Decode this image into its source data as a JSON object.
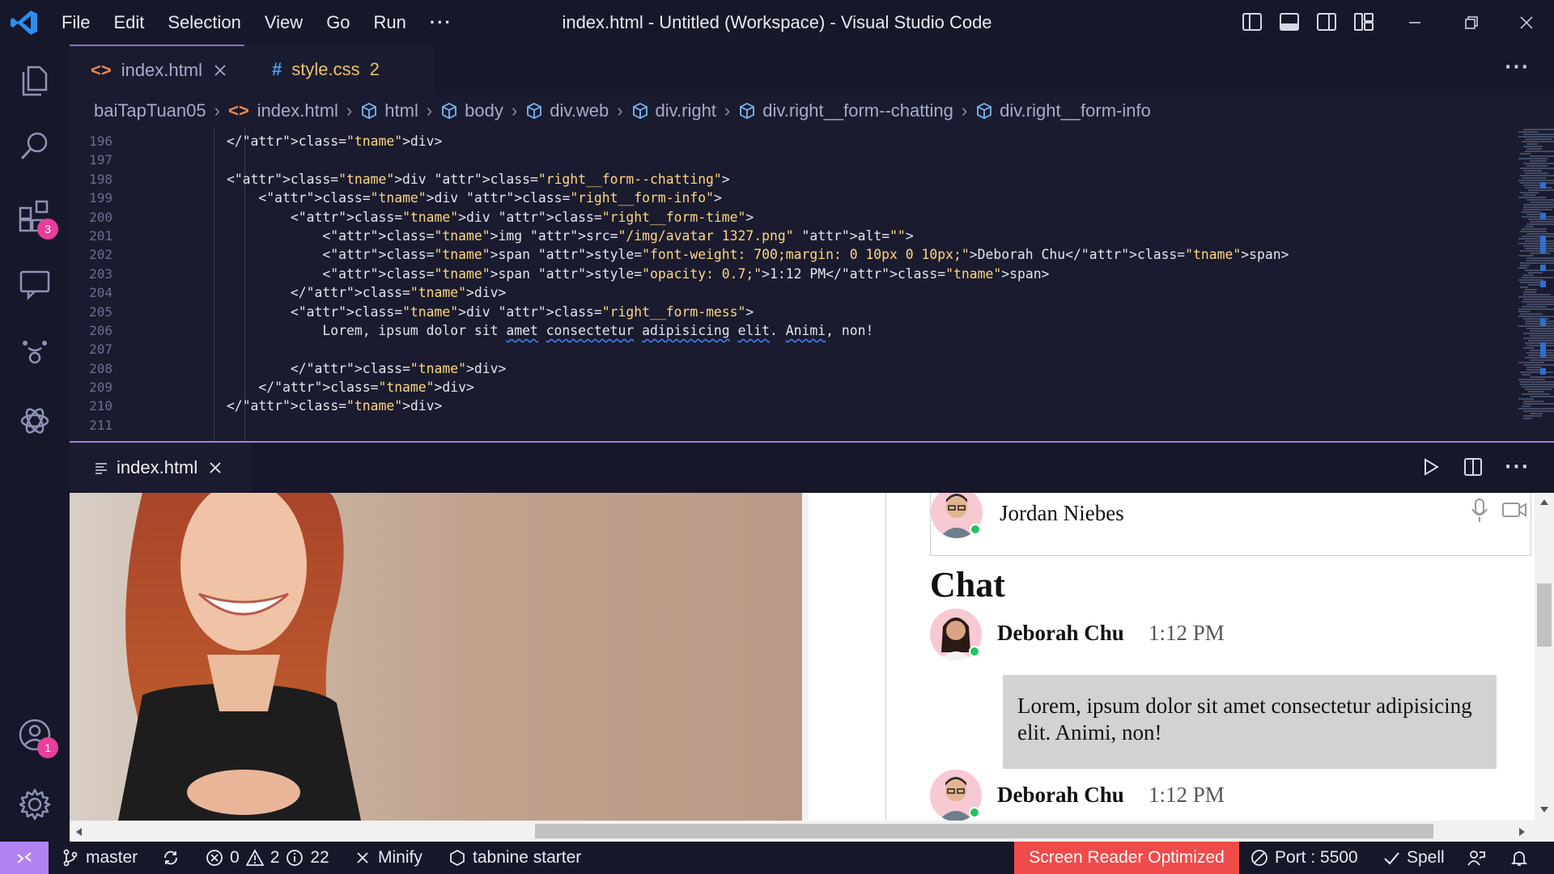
{
  "window": {
    "title": "index.html - Untitled (Workspace) - Visual Studio Code",
    "menu": [
      "File",
      "Edit",
      "Selection",
      "View",
      "Go",
      "Run"
    ],
    "menu_more": "···"
  },
  "activity": {
    "extensions_badge": "3",
    "accounts_badge": "1"
  },
  "tabs": [
    {
      "label": "index.html",
      "icon": "<>",
      "modified": false
    },
    {
      "label": "style.css",
      "icon": "#",
      "count": "2"
    }
  ],
  "breadcrumb": [
    "baiTapTuan05",
    "index.html",
    "html",
    "body",
    "div.web",
    "div.right",
    "div.right__form--chatting",
    "div.right__form-info"
  ],
  "code": {
    "line_numbers": [
      "196",
      "197",
      "198",
      "199",
      "200",
      "201",
      "202",
      "203",
      "204",
      "205",
      "206",
      "207",
      "208",
      "209",
      "210",
      "211"
    ],
    "lines": [
      "        </div>",
      "",
      "        <div class=\"right__form--chatting\">",
      "            <div class=\"right__form-info\">",
      "                <div class=\"right__form-time\">",
      "                    <img src=\"/img/avatar 1327.png\" alt=\"\">",
      "                    <span style=\"font-weight: 700;margin: 0 10px 0 10px;\">Deborah Chu</span>",
      "                    <span style=\"opacity: 0.7;\">1:12 PM</span>",
      "                </div>",
      "                <div class=\"right__form-mess\">",
      "                    Lorem, ipsum dolor sit amet consectetur adipisicing elit. Animi, non!",
      "",
      "                </div>",
      "            </div>",
      "        </div>",
      ""
    ]
  },
  "preview_panel": {
    "tab_label": "index.html"
  },
  "page": {
    "call_name": "Jordan Niebes",
    "chat_heading": "Chat",
    "messages": [
      {
        "name": "Deborah Chu",
        "time": "1:12 PM",
        "text": "Lorem, ipsum dolor sit amet consectetur adipisicing elit. Animi, non!"
      },
      {
        "name": "Deborah Chu",
        "time": "1:12 PM"
      }
    ]
  },
  "status": {
    "branch": "master",
    "errors": "0",
    "warnings": "2",
    "info": "22",
    "minify": "Minify",
    "tabnine": "tabnine starter",
    "screen_reader": "Screen Reader Optimized",
    "port": "Port : 5500",
    "spell": "Spell"
  },
  "colors": {
    "accent": "#b083f0",
    "screen_reader_bg": "#ef4b4b",
    "badge": "#e83e9c"
  }
}
